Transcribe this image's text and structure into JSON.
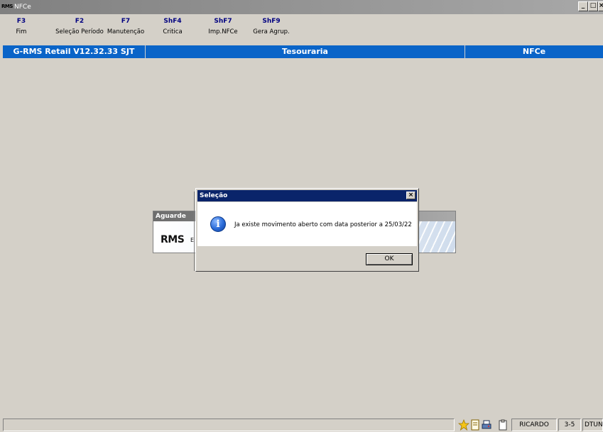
{
  "window": {
    "app_icon_text": "RMS",
    "title": "NFCe",
    "min_glyph": "_",
    "max_glyph": "□",
    "close_glyph": "×"
  },
  "toolbar": {
    "keys": [
      {
        "key": "F3",
        "label": "Fim"
      },
      {
        "key": "F2",
        "label": "Seleção Período"
      },
      {
        "key": "F7",
        "label": "Manutenção"
      },
      {
        "key": "ShF4",
        "label": "Critica"
      },
      {
        "key": "ShF7",
        "label": "Imp.NFCe"
      },
      {
        "key": "ShF9",
        "label": "Gera Agrup."
      }
    ]
  },
  "header": {
    "system": "G-RMS Retail V12.32.33 SJT",
    "module": "Tesouraria",
    "screen": "NFCe"
  },
  "aguarde": {
    "title": "Aguarde",
    "logo": "RMS",
    "logo_sub": "E"
  },
  "dialog": {
    "title": "Seleção",
    "close_glyph": "×",
    "icon": "info-icon",
    "message": "Ja existe movimento aberto com data posterior a 25/03/22",
    "ok_label": "OK"
  },
  "statusbar": {
    "user": "RICARDO",
    "code": "3-5",
    "extra": "DTUNF"
  },
  "colors": {
    "desktop_bg": "#d4d0c8",
    "header_blue": "#0a64c8",
    "dialog_title": "#0a246a",
    "fkey_text": "#000080"
  }
}
